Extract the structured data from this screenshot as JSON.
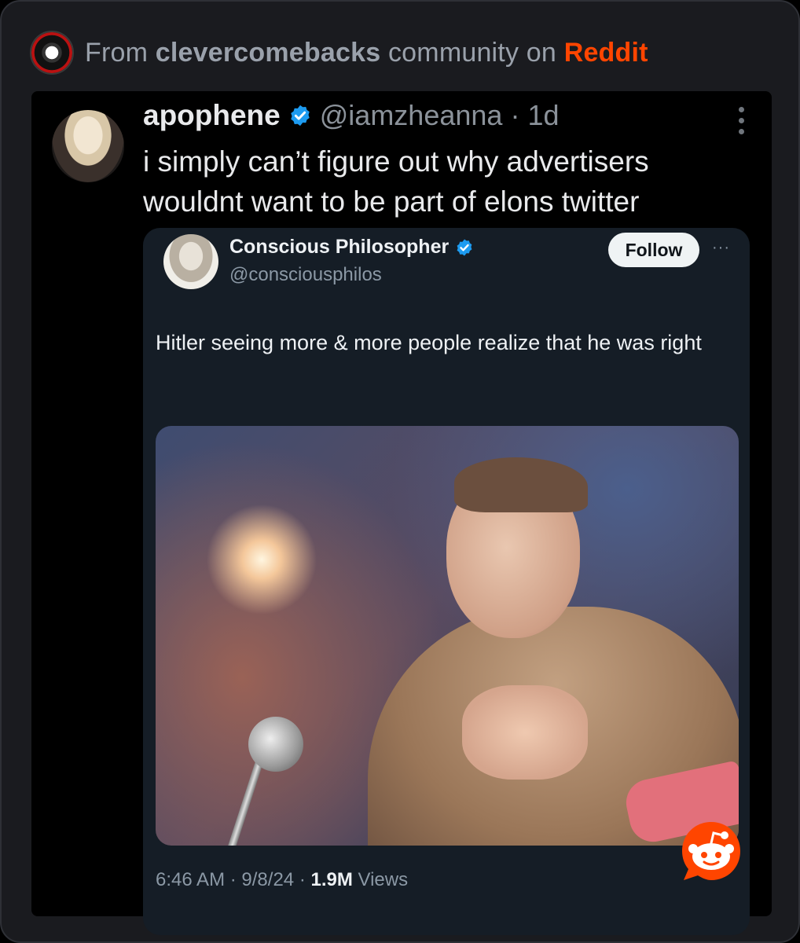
{
  "header": {
    "prefix": "From",
    "community": "clevercomebacks",
    "middle": "community on",
    "platform": "Reddit"
  },
  "tweet": {
    "display_name": "apophene",
    "handle": "@iamzheanna",
    "separator": "·",
    "time": "1d",
    "text": "i simply can’t figure out why advertisers wouldnt want to be part of elons twitter"
  },
  "quoted_tweet": {
    "display_name": "Conscious Philosopher",
    "handle": "@consciousphilos",
    "follow_label": "Follow",
    "more_label": "···",
    "text": "Hitler seeing more & more people realize that he was right",
    "time": "6:46 AM",
    "date": "9/8/24",
    "views_count": "1.9M",
    "views_label": "Views",
    "separator": "·"
  },
  "colors": {
    "reddit_orange": "#ff4500",
    "verified_blue": "#1d9bf0"
  }
}
